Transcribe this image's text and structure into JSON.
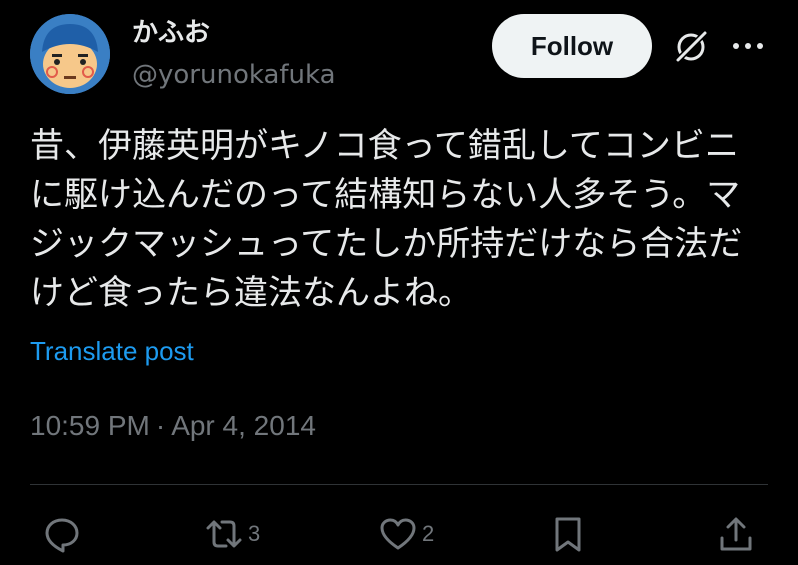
{
  "user": {
    "display_name": "かふお",
    "handle": "@yorunokafuka"
  },
  "header": {
    "follow_label": "Follow"
  },
  "tweet": {
    "lines": [
      "昔、伊藤英明がキノコ食って錯乱してコンビニ",
      "に駆け込んだのって結構知らない人多そう。マ",
      "ジックマッシュってたしか所持だけなら合法だ",
      "けど食ったら違法なんよね。"
    ],
    "translate_label": "Translate post",
    "time": "10:59 PM",
    "separator": "·",
    "date": "Apr 4, 2014"
  },
  "actions": {
    "reply": {
      "icon": "reply-icon"
    },
    "retweet": {
      "icon": "retweet-icon",
      "count": "3"
    },
    "like": {
      "icon": "heart-icon",
      "count": "2"
    },
    "bookmark": {
      "icon": "bookmark-icon"
    },
    "share": {
      "icon": "share-icon"
    }
  },
  "colors": {
    "background": "#000000",
    "text": "#e7e9ea",
    "muted": "#71767b",
    "link": "#1d9bf0",
    "follow_bg": "#eff3f4"
  }
}
